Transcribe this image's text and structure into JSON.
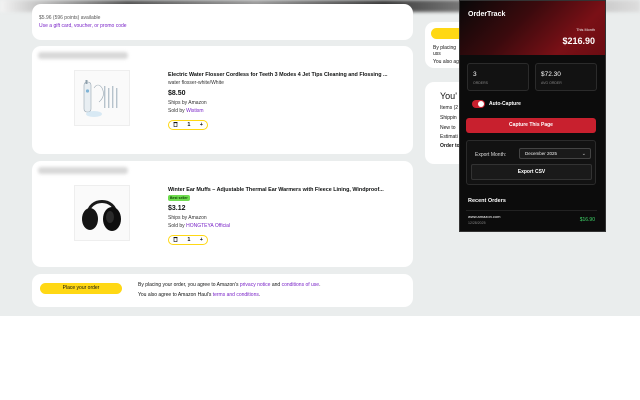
{
  "header": {
    "points_note": "$5.96 (596 points) available",
    "promo_link": "Use a gift card, voucher, or promo code"
  },
  "items": [
    {
      "title": "Electric Water Flosser Cordless for Teeth 3 Modes 4 Jet Tips Cleaning and Flossing ...",
      "variant": "water flosser-white/White",
      "price": "$8.50",
      "ships": "Ships by Amazon",
      "sold_prefix": "Sold by ",
      "seller": "Wistism",
      "qty": "1"
    },
    {
      "title": "Winter Ear Muffs – Adjustable Thermal Ear Warmers with Fleece Lining, Windproof...",
      "badge": "Best seller",
      "price": "$3.12",
      "ships": "Ships by Amazon",
      "sold_prefix": "Sold by ",
      "seller": "HONGTEYA Official",
      "qty": "1"
    }
  ],
  "footer": {
    "place_order": "Place your order",
    "agree_prefix": "By placing your order, you agree to Amazon's ",
    "privacy": "privacy notice",
    "and": " and ",
    "conditions": "conditions of use",
    "dot": ".",
    "haul_prefix": "You also agree to Amazon Haul's ",
    "haul_terms": "terms and conditions",
    "haul_dot": "."
  },
  "summary": {
    "agree_line": "By placing",
    "uss": "uss",
    "also_line": "You also agre",
    "heading": "You'",
    "rows": [
      "Items (2",
      "Shippin",
      "New to",
      "Estimati"
    ],
    "order_total": "Order to"
  },
  "popup": {
    "title": "OrderTrack",
    "month_label": "This Month",
    "month_total": "$216.90",
    "orders_value": "3",
    "orders_label": "ORDERS",
    "avg_value": "$72.30",
    "avg_label": "AVG ORDER",
    "auto_capture": "Auto-Capture",
    "capture_btn": "Capture This Page",
    "export_month_label": "Export Month:",
    "export_month_value": "December 2025",
    "export_csv": "Export CSV",
    "recent_heading": "Recent Orders",
    "recent": [
      {
        "site": "www.amazon.com",
        "date": "12/28/2025",
        "amount": "$16.90"
      }
    ]
  },
  "colors": {
    "accent": "#c8202e",
    "yellow": "#ffd814",
    "green": "#3fd86a"
  }
}
